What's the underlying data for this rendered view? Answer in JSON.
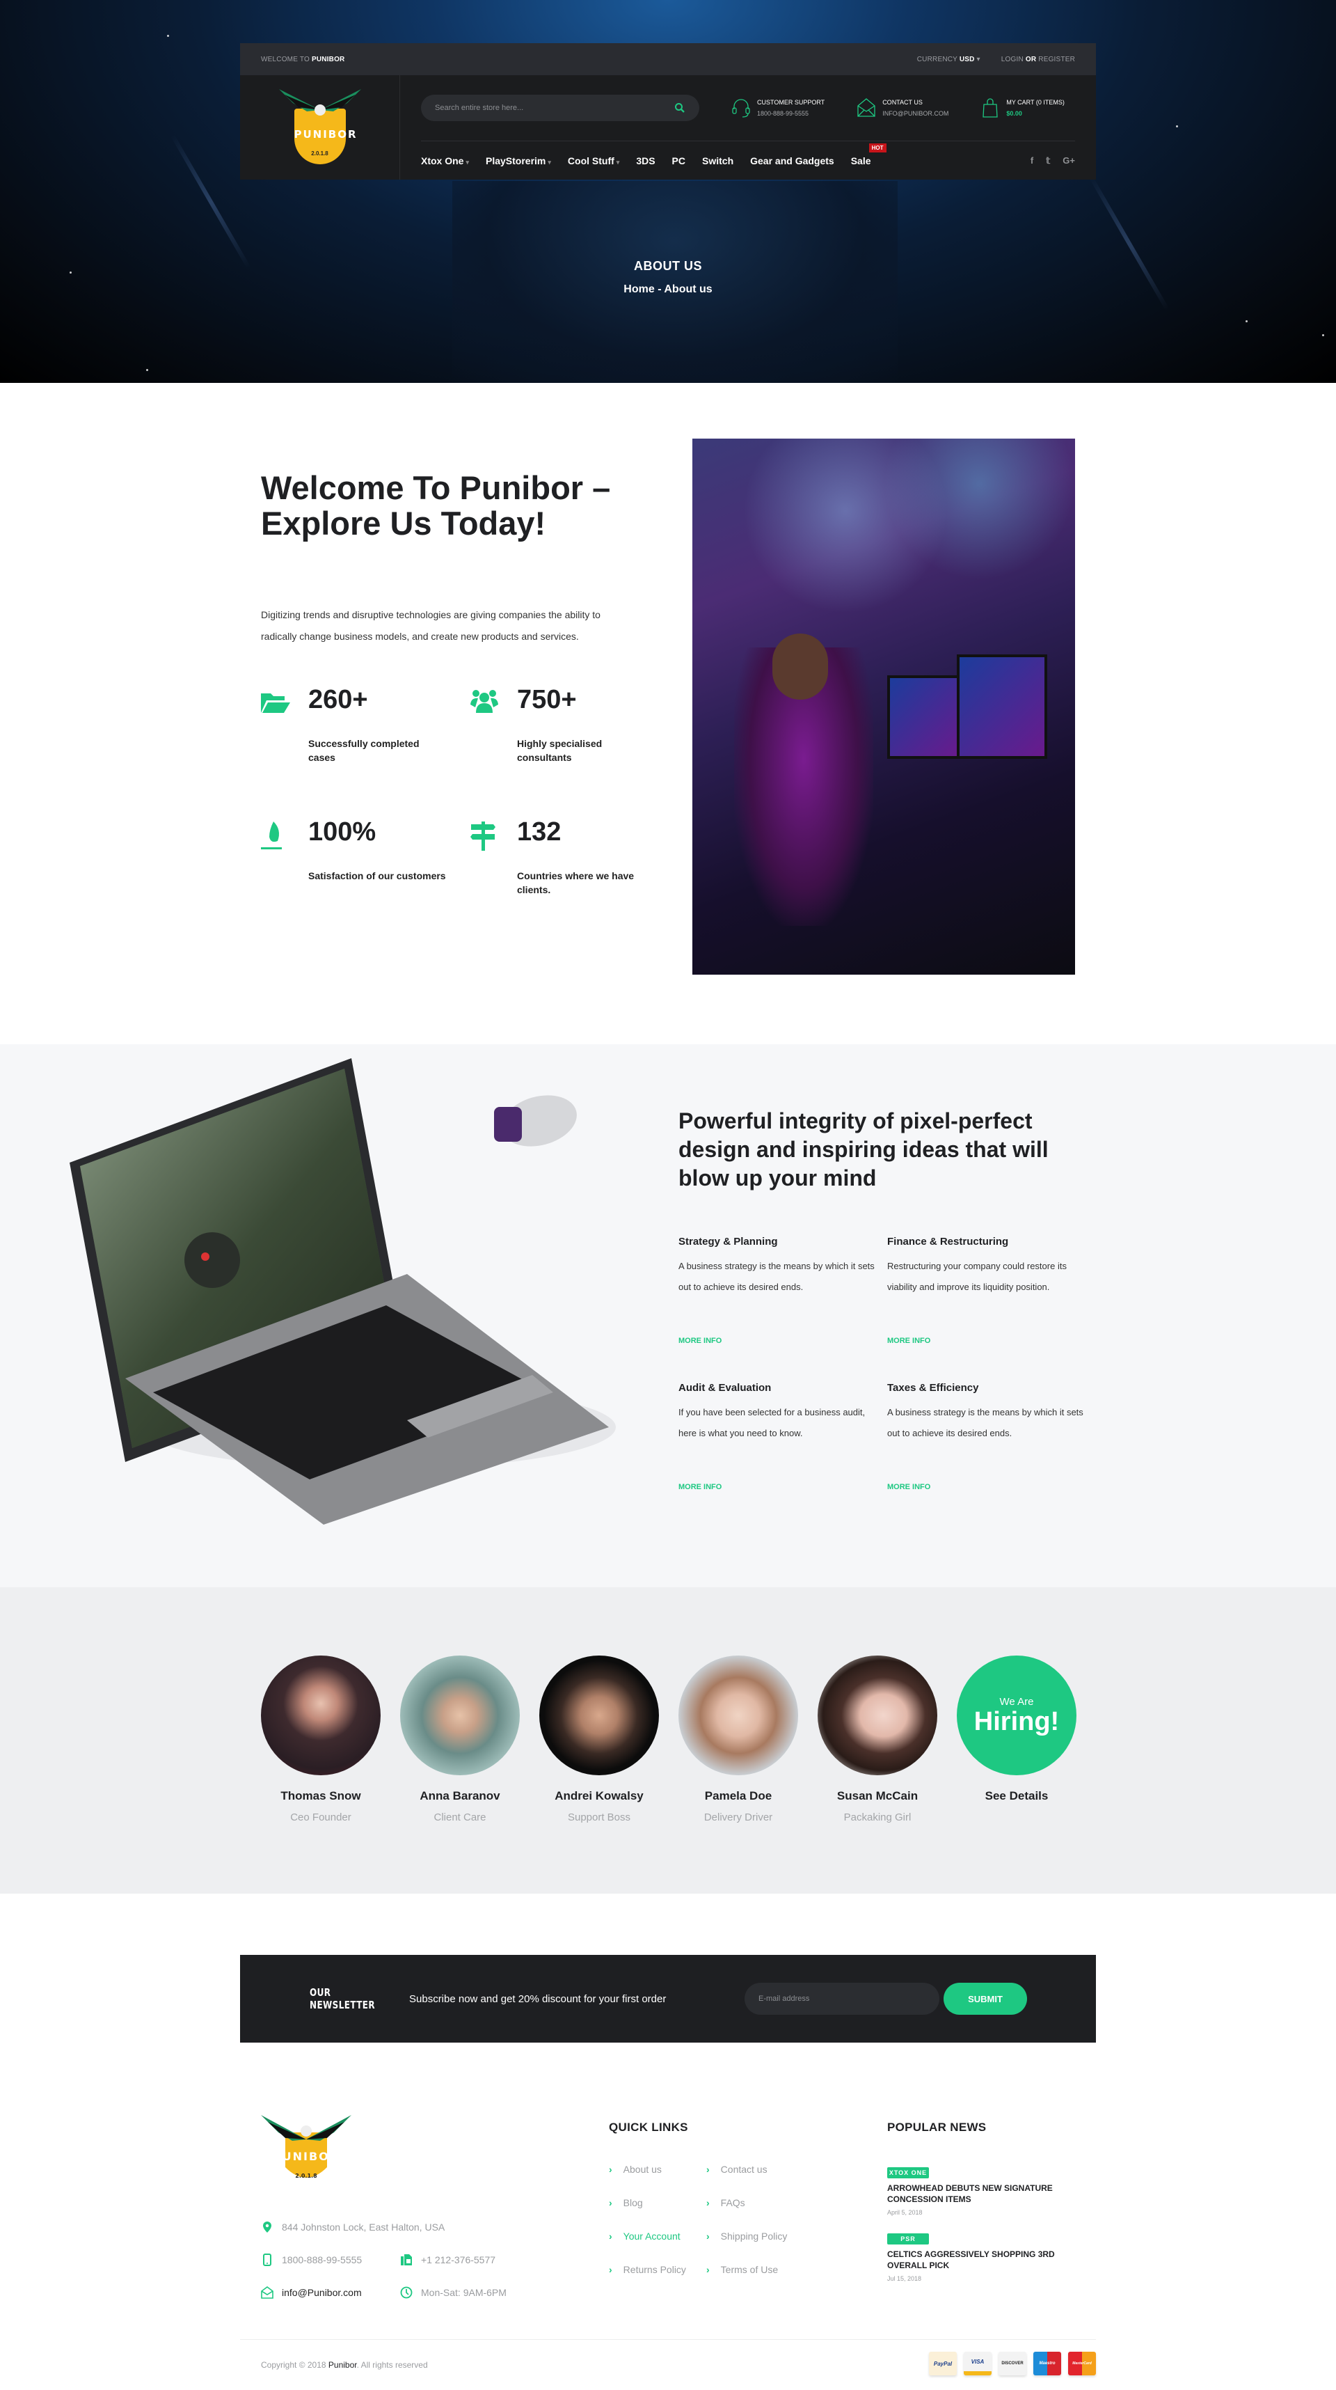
{
  "colors": {
    "accent": "#1ec882",
    "dark": "#1e1f22",
    "topbar": "#2a2c31",
    "hot": "#c7141a",
    "logo_gold": "#f5b81a"
  },
  "topbar": {
    "welcome_prefix": "WELCOME TO",
    "welcome_brand": "PUNIBOR",
    "currency_label": "CURRENCY",
    "currency_value": "USD",
    "login": "LOGIN",
    "or": "OR",
    "register": "REGISTER"
  },
  "logo": {
    "word": "PUNIBOR",
    "year": "2.0.1.8"
  },
  "search": {
    "placeholder": "Search entire store here..."
  },
  "header_info": [
    {
      "icon": "headset-icon",
      "title": "CUSTOMER SUPPORT",
      "sub": "1800-888-99-5555"
    },
    {
      "icon": "envelope-icon",
      "title": "CONTACT US",
      "sub": "INFO@PUNIBOR.COM"
    },
    {
      "icon": "shopping-bag-icon",
      "title": "MY CART (0 ITEMS)",
      "sub": "$0.00"
    }
  ],
  "nav": [
    {
      "label": "Xtox One",
      "dropdown": true
    },
    {
      "label": "PlayStorerim",
      "dropdown": true
    },
    {
      "label": "Cool Stuff",
      "dropdown": true
    },
    {
      "label": "3DS",
      "dropdown": false
    },
    {
      "label": "PC",
      "dropdown": false
    },
    {
      "label": "Switch",
      "dropdown": false
    },
    {
      "label": "Gear and Gadgets",
      "dropdown": false
    },
    {
      "label": "Sale",
      "dropdown": false,
      "badge": "HOT"
    }
  ],
  "social": [
    "facebook-icon",
    "twitter-icon",
    "google-plus-icon"
  ],
  "page_title": {
    "title": "ABOUT US",
    "breadcrumb": "Home - About us"
  },
  "about": {
    "heading": "Welcome To Punibor – Explore Us Today!",
    "intro": "Digitizing trends and disruptive technologies are giving companies the ability to radically change business models, and create new products and services.",
    "stats": [
      {
        "icon": "folder-open-icon",
        "value": "260+",
        "label": "Successfully completed cases"
      },
      {
        "icon": "users-icon",
        "value": "750+",
        "label": "Highly specialised consultants"
      },
      {
        "icon": "fire-icon",
        "value": "100%",
        "label": "Satisfaction of our customers"
      },
      {
        "icon": "signpost-icon",
        "value": "132",
        "label": "Countries where we have clients."
      }
    ]
  },
  "features": {
    "heading": "Powerful integrity of pixel-perfect design and inspiring ideas that will blow up your mind",
    "cards": [
      {
        "title": "Strategy & Planning",
        "text": "A business strategy is the means by which it sets out to achieve its desired ends.",
        "link": "MORE INFO"
      },
      {
        "title": "Finance & Restructuring",
        "text": "Restructuring your company could restore its viability and improve its liquidity position.",
        "link": "MORE INFO"
      },
      {
        "title": "Audit & Evaluation",
        "text": "If you have been selected for a business audit, here is what you need to know.",
        "link": "MORE INFO"
      },
      {
        "title": "Taxes & Efficiency",
        "text": "A business strategy is the means by which it sets out to achieve its desired ends.",
        "link": "MORE INFO"
      }
    ]
  },
  "team": {
    "members": [
      {
        "name": "Thomas Snow",
        "role": "Ceo Founder"
      },
      {
        "name": "Anna Baranov",
        "role": "Client Care"
      },
      {
        "name": "Andrei Kowalsy",
        "role": "Support Boss"
      },
      {
        "name": "Pamela Doe",
        "role": "Delivery Driver"
      },
      {
        "name": "Susan McCain",
        "role": "Packaking Girl"
      }
    ],
    "hiring": {
      "small": "We Are",
      "big": "Hiring!",
      "link": "See Details"
    }
  },
  "newsletter": {
    "title": "OUR NEWSLETTER",
    "text": "Subscribe now and get 20% discount for your first order",
    "placeholder": "E-mail address",
    "button": "SUBMIT"
  },
  "footer": {
    "address": "844 Johnston Lock, East Halton, USA",
    "phone": "1800-888-99-5555",
    "fax": "+1 212-376-5577",
    "email": "info@Punibor.com",
    "hours": "Mon-Sat: 9AM-6PM",
    "quick_links_title": "QUICK LINKS",
    "quick_links": [
      {
        "label": "About us",
        "active": false
      },
      {
        "label": "Contact us",
        "active": false
      },
      {
        "label": "Blog",
        "active": false
      },
      {
        "label": "FAQs",
        "active": false
      },
      {
        "label": "Your Account",
        "active": true
      },
      {
        "label": "Shipping Policy",
        "active": false
      },
      {
        "label": "Returns Policy",
        "active": false
      },
      {
        "label": "Terms of Use",
        "active": false
      }
    ],
    "news_title": "POPULAR NEWS",
    "news": [
      {
        "tag": "XTOX ONE",
        "title": "ARROWHEAD DEBUTS NEW SIGNATURE CONCESSION ITEMS",
        "date": "April 5, 2018"
      },
      {
        "tag": "PSR",
        "title": "CELTICS AGGRESSIVELY SHOPPING 3RD OVERALL PICK",
        "date": "Jul 15, 2018"
      }
    ],
    "copyright_prefix": "Copyright © 2018",
    "copyright_brand": "Punibor",
    "copyright_suffix": ". All rights reserved",
    "payments": [
      "PayPal",
      "VISA",
      "DISCOVER",
      "Maestro",
      "MasterCard"
    ]
  }
}
